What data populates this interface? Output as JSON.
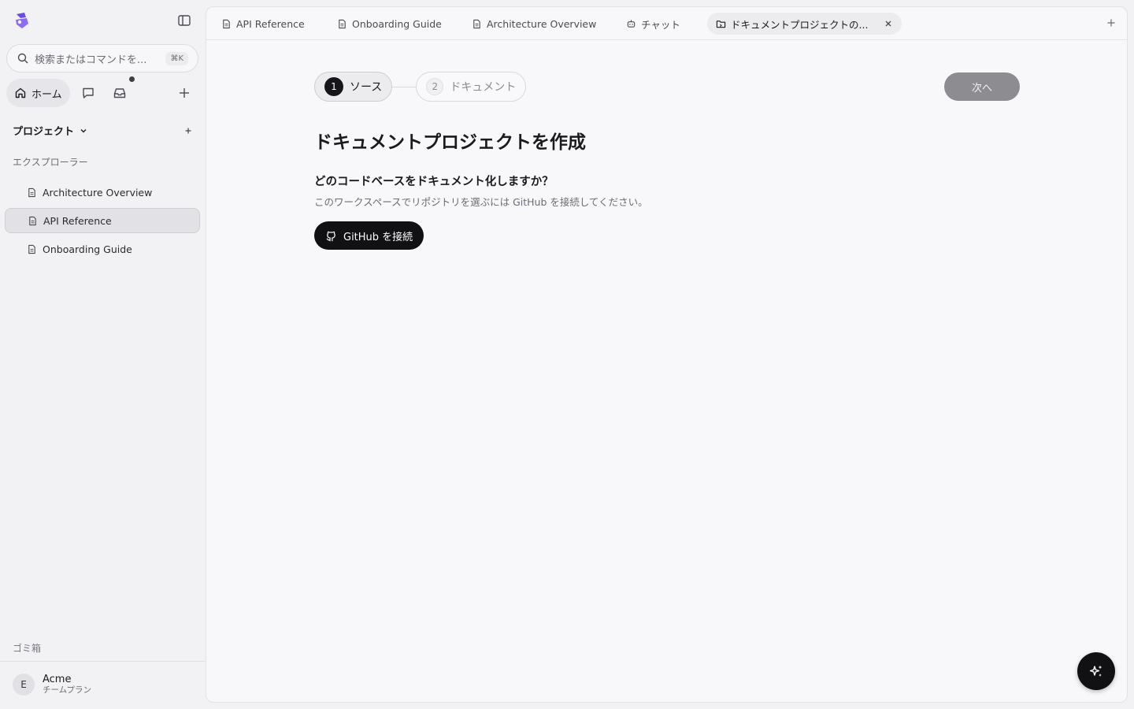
{
  "sidebar": {
    "search_placeholder": "検索またはコマンドを...",
    "search_shortcut": "⌘K",
    "home_label": "ホーム",
    "projects_label": "プロジェクト",
    "explorer_label": "エクスプローラー",
    "items": [
      {
        "label": "Architecture Overview"
      },
      {
        "label": "API Reference"
      },
      {
        "label": "Onboarding Guide"
      }
    ],
    "trash_label": "ゴミ箱",
    "account": {
      "initial": "E",
      "name": "Acme",
      "plan": "チームプラン"
    }
  },
  "tabs": [
    {
      "label": "API Reference",
      "icon": "file-icon"
    },
    {
      "label": "Onboarding Guide",
      "icon": "file-icon"
    },
    {
      "label": "Architecture Overview",
      "icon": "file-icon"
    },
    {
      "label": "チャット",
      "icon": "bot-icon"
    },
    {
      "label": "ドキュメントプロジェクトの...",
      "icon": "folder-code-icon"
    }
  ],
  "wizard": {
    "steps": [
      {
        "num": "1",
        "label": "ソース"
      },
      {
        "num": "2",
        "label": "ドキュメント"
      }
    ],
    "next_label": "次へ",
    "title": "ドキュメントプロジェクトを作成",
    "question": "どのコードベースをドキュメント化しますか？",
    "description": "このワークスペースでリポジトリを選ぶには GitHub を接続してください。",
    "connect_label": "GitHub を接続"
  },
  "colors": {
    "accent_dark": "#111114",
    "logo": "#7b5cf0"
  }
}
